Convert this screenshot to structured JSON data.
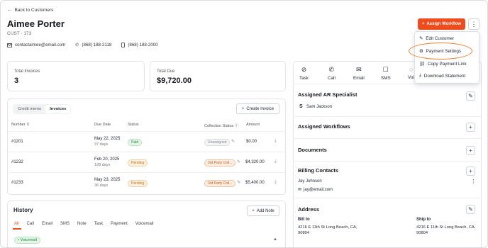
{
  "back_label": "Back to Customers",
  "customer": {
    "name": "Aimee Porter",
    "id": "CUST · 173",
    "email": "contactaimee@email.com",
    "phone": "(868) 188-2118",
    "mobile": "(868) 188-2000"
  },
  "header_buttons": {
    "assign": "Assign Workflow",
    "more": "⋮"
  },
  "menu": {
    "items": [
      "Edit Customer",
      "Payment Settings",
      "Copy Payment Link",
      "Download Statement"
    ]
  },
  "stats": {
    "total_invoices_label": "Total Invoices",
    "total_invoices": "3",
    "total_due_label": "Total Due",
    "total_due": "$9,720.00"
  },
  "tabs": [
    "Credit memo",
    "Invoices"
  ],
  "create_invoice": "Create Invoice",
  "table": {
    "headers": [
      "Number",
      "Due Date",
      "Status",
      "Collection Status",
      "Amount"
    ],
    "rows": [
      {
        "number": "#1201",
        "date": "May 22, 2025",
        "days": "37 days",
        "status": "Paid",
        "collection": "Unassigned",
        "amount": "$0.00"
      },
      {
        "number": "#1232",
        "date": "Feb 20, 2025",
        "days": "128 days",
        "status": "Pending",
        "collection": "3rd Party Coll...",
        "amount": "$4,320.00"
      },
      {
        "number": "#1233",
        "date": "May 23, 2025",
        "days": "36 days",
        "status": "Pending",
        "collection": "3rd Party Coll...",
        "amount": "$5,400.00"
      }
    ]
  },
  "history": {
    "title": "History",
    "add_note": "Add Note",
    "tabs": [
      "All",
      "Call",
      "Email",
      "SMS",
      "Note",
      "Task",
      "Payment",
      "Voicemail"
    ],
    "badge": "Voicemail"
  },
  "actions": [
    "Task",
    "Call",
    "Email",
    "SMS",
    "Voi"
  ],
  "sections": {
    "ar_specialist": "Assigned AR Specialist",
    "specialist_initial": "S",
    "specialist_name": "Sam Jackson",
    "workflows": "Assigned Workflows",
    "documents": "Documents",
    "billing": "Billing Contacts",
    "billing_name": "Jay Johnson",
    "billing_email": "jay@email.com",
    "address": "Address",
    "bill_to": "Bill to",
    "ship_to": "Ship to",
    "bill_addr1": "4216 E 11th St Long Beach, CA,",
    "bill_addr2": "90804",
    "ship_addr1": "4216 E 11th St Long Beach, CA,",
    "ship_addr2": "90804"
  },
  "colors": {
    "accent": "#ee4c1c",
    "highlight": "#e88133"
  }
}
